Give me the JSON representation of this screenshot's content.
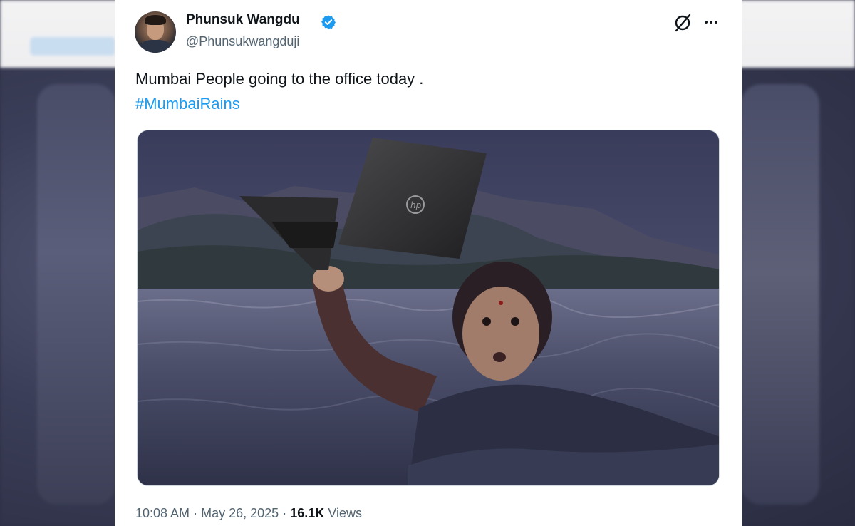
{
  "author": {
    "name": "Phunsuk Wangdu",
    "handle": "@Phunsukwangduji",
    "verified_color": "#1d9bf0"
  },
  "tweet": {
    "text": "Mumbai People going to the office today .",
    "hashtag": "#MumbaiRains"
  },
  "meta": {
    "time": "10:08 AM",
    "separator": "·",
    "date": "May 26, 2025",
    "views_count": "16.1K",
    "views_label": "Views"
  },
  "icons": {
    "avatar": "avatar",
    "verified": "verified-badge-icon",
    "grok": "grok-icon",
    "more": "more-icon"
  },
  "colors": {
    "text_primary": "#0f1419",
    "text_secondary": "#536471",
    "link": "#1d9bf0"
  }
}
